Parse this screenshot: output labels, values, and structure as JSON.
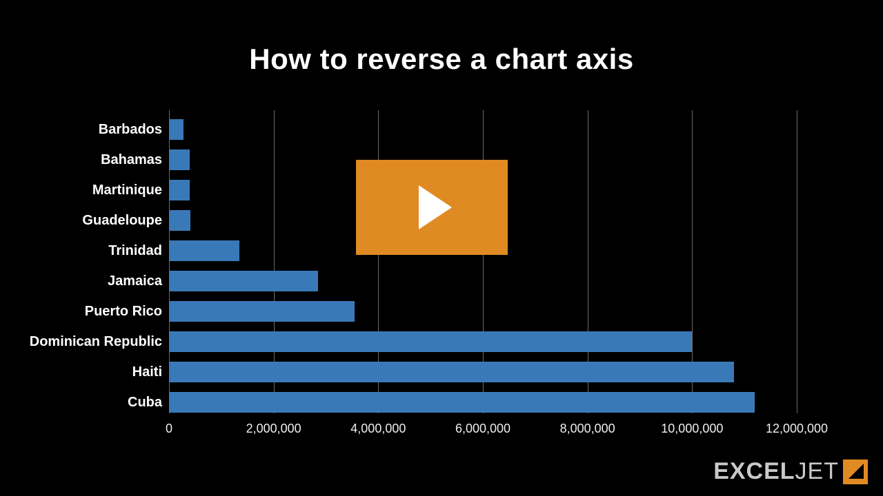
{
  "title": "How to reverse a chart axis",
  "brand": {
    "strong": "EXCEL",
    "light": "JET"
  },
  "chart_data": {
    "type": "bar",
    "orientation": "horizontal",
    "categories": [
      "Barbados",
      "Bahamas",
      "Martinique",
      "Guadeloupe",
      "Trinidad",
      "Jamaica",
      "Puerto Rico",
      "Dominican Republic",
      "Haiti",
      "Cuba"
    ],
    "values": [
      280000,
      390000,
      400000,
      410000,
      1350000,
      2850000,
      3550000,
      10000000,
      10800000,
      11200000
    ],
    "xlabel": "",
    "ylabel": "",
    "xlim": [
      0,
      12000000
    ],
    "xticks": [
      0,
      2000000,
      4000000,
      6000000,
      8000000,
      10000000,
      12000000
    ],
    "xtick_labels": [
      "0",
      "2,000,000",
      "4,000,000",
      "6,000,000",
      "8,000,000",
      "10,000,000",
      "12,000,000"
    ],
    "bar_color": "#3a79b7"
  }
}
